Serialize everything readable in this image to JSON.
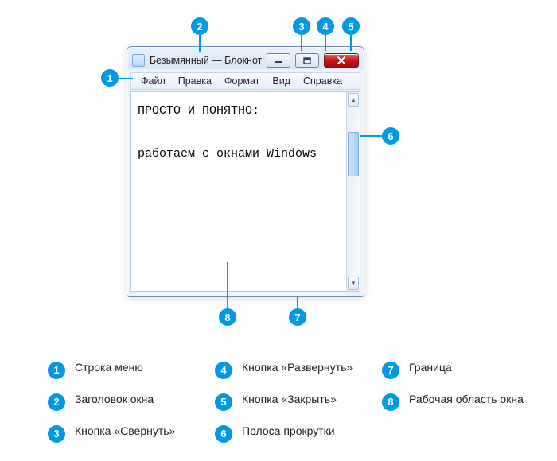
{
  "window": {
    "title": "Безымянный — Блокнот",
    "menus": [
      "Файл",
      "Правка",
      "Формат",
      "Вид",
      "Справка"
    ],
    "content_line1": "ПРОСТО И ПОНЯТНО:",
    "content_line2": "работаем с окнами Windows",
    "min_glyph": "—",
    "max_glyph": "▭",
    "close_glyph": "✕",
    "scroll_up": "▲",
    "scroll_down": "▼"
  },
  "callouts": {
    "n1": "1",
    "n2": "2",
    "n3": "3",
    "n4": "4",
    "n5": "5",
    "n6": "6",
    "n7": "7",
    "n8": "8"
  },
  "legend": [
    {
      "n": "1",
      "label": "Строка меню"
    },
    {
      "n": "2",
      "label": "Заголовок окна"
    },
    {
      "n": "3",
      "label": "Кнопка «Свернуть»"
    },
    {
      "n": "4",
      "label": "Кнопка «Развернуть»"
    },
    {
      "n": "5",
      "label": "Кнопка «Закрыть»"
    },
    {
      "n": "6",
      "label": "Полоса прокрутки"
    },
    {
      "n": "7",
      "label": "Граница"
    },
    {
      "n": "8",
      "label": "Рабочая область окна"
    }
  ]
}
